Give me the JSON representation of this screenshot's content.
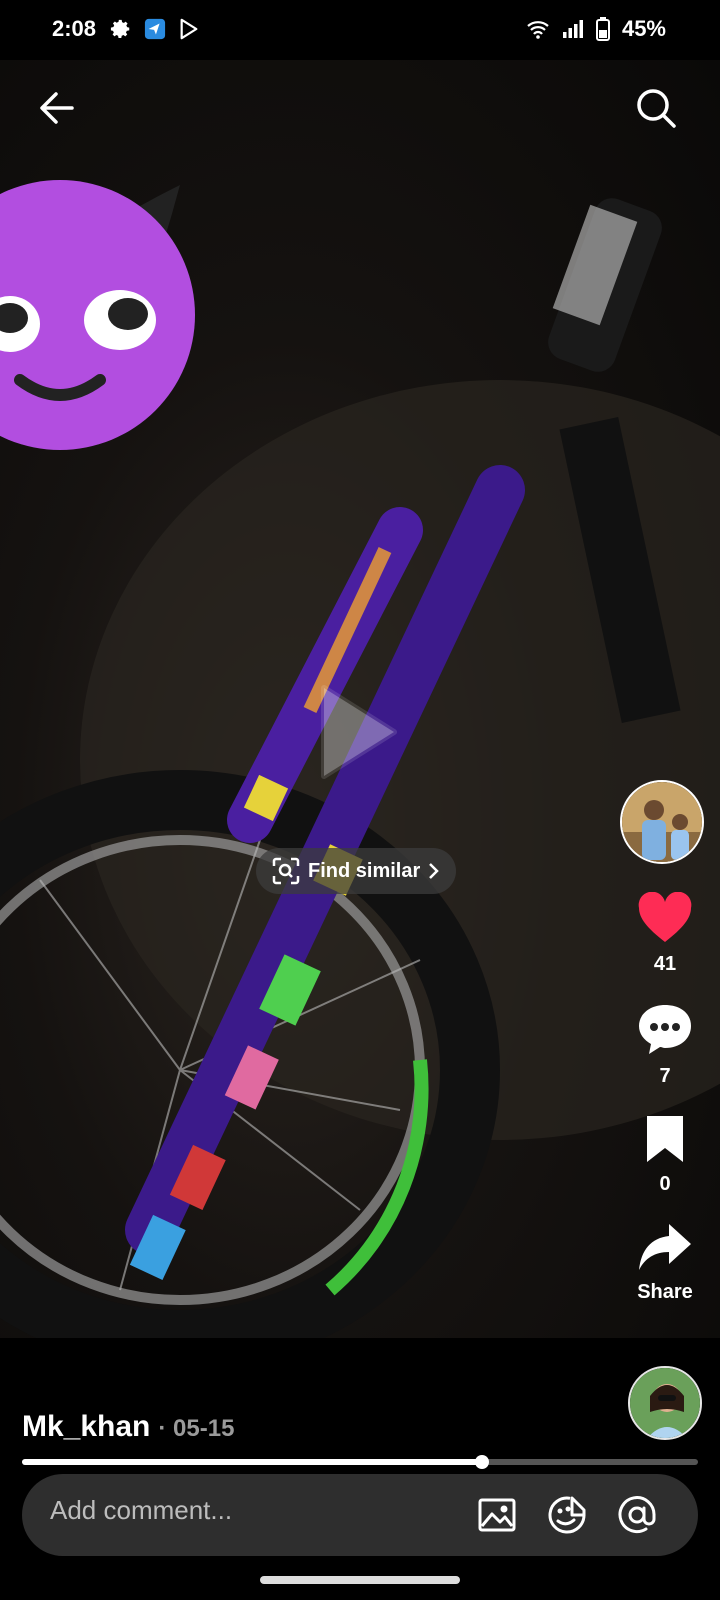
{
  "status": {
    "time": "2:08",
    "battery": "45%"
  },
  "overlay": {
    "find_similar_label": "Find similar"
  },
  "actions": {
    "likes": "41",
    "comments": "7",
    "saves": "0",
    "share_label": "Share"
  },
  "post": {
    "author": "Mk_khan",
    "date": "· 05-15"
  },
  "playback": {
    "progress_percent": 68
  },
  "comment": {
    "placeholder": "Add comment..."
  },
  "colors": {
    "like": "#fe2c55",
    "background": "#000000"
  },
  "icons": {
    "back": "arrow-left-icon",
    "search": "search-icon",
    "play": "play-icon",
    "like": "heart-icon",
    "comment": "comment-bubble-icon",
    "save": "bookmark-icon",
    "share": "share-arrow-icon",
    "image": "image-icon",
    "emoji": "emoji-icon",
    "mention": "at-sign-icon"
  }
}
